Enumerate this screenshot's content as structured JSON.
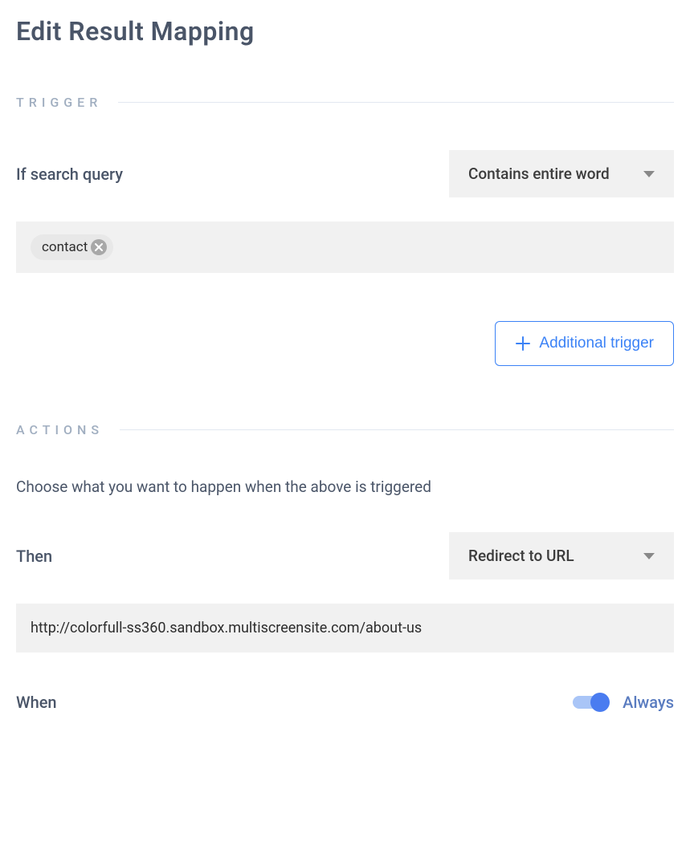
{
  "page": {
    "title": "Edit Result Mapping"
  },
  "trigger": {
    "section_label": "TRIGGER",
    "if_label": "If search query",
    "condition_select": "Contains entire word",
    "tags": [
      {
        "text": "contact"
      }
    ],
    "additional_button": "Additional trigger"
  },
  "actions": {
    "section_label": "ACTIONS",
    "helper_text": "Choose what you want to happen when the above is triggered",
    "then_label": "Then",
    "then_select": "Redirect to URL",
    "url_value": "http://colorfull-ss360.sandbox.multiscreensite.com/about-us",
    "when_label": "When",
    "toggle_state": true,
    "toggle_label": "Always"
  }
}
